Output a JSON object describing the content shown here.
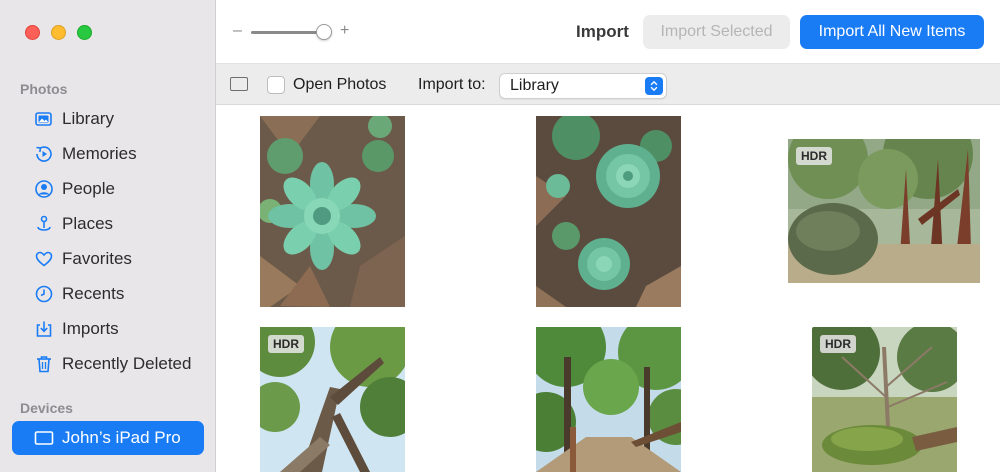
{
  "window": {
    "sidebar": {
      "sections": [
        {
          "label": "Photos",
          "items": [
            {
              "label": "Library",
              "icon": "library-icon"
            },
            {
              "label": "Memories",
              "icon": "memories-icon"
            },
            {
              "label": "People",
              "icon": "people-icon"
            },
            {
              "label": "Places",
              "icon": "places-icon"
            },
            {
              "label": "Favorites",
              "icon": "heart-icon"
            },
            {
              "label": "Recents",
              "icon": "clock-icon"
            },
            {
              "label": "Imports",
              "icon": "imports-icon"
            },
            {
              "label": "Recently Deleted",
              "icon": "trash-icon"
            }
          ]
        },
        {
          "label": "Devices",
          "items": [
            {
              "label": "John’s iPad Pro",
              "icon": "ipad-icon",
              "selected": true
            }
          ]
        }
      ]
    },
    "toolbar": {
      "zoom_minus": "–",
      "zoom_plus": "+",
      "zoom_level": 0.9,
      "title": "Import",
      "import_selected_label": "Import Selected",
      "import_all_label": "Import All New Items"
    },
    "subbar": {
      "open_photos_label": "Open Photos",
      "open_photos_checked": false,
      "import_to_label": "Import to:",
      "import_to_value": "Library"
    },
    "photos": [
      {
        "badge": "",
        "subject": "succulent"
      },
      {
        "badge": "",
        "subject": "succulents"
      },
      {
        "badge": "HDR",
        "subject": "forest-rock"
      },
      {
        "badge": "HDR",
        "subject": "tree-canopy"
      },
      {
        "badge": "",
        "subject": "forest-path"
      },
      {
        "badge": "HDR",
        "subject": "fallen-log"
      }
    ],
    "colors": {
      "accent": "#1a7cf5",
      "sidebar_bg": "#e8e6e8",
      "close": "#fe5f57",
      "minimize": "#febc2e",
      "zoom": "#28c840"
    }
  }
}
